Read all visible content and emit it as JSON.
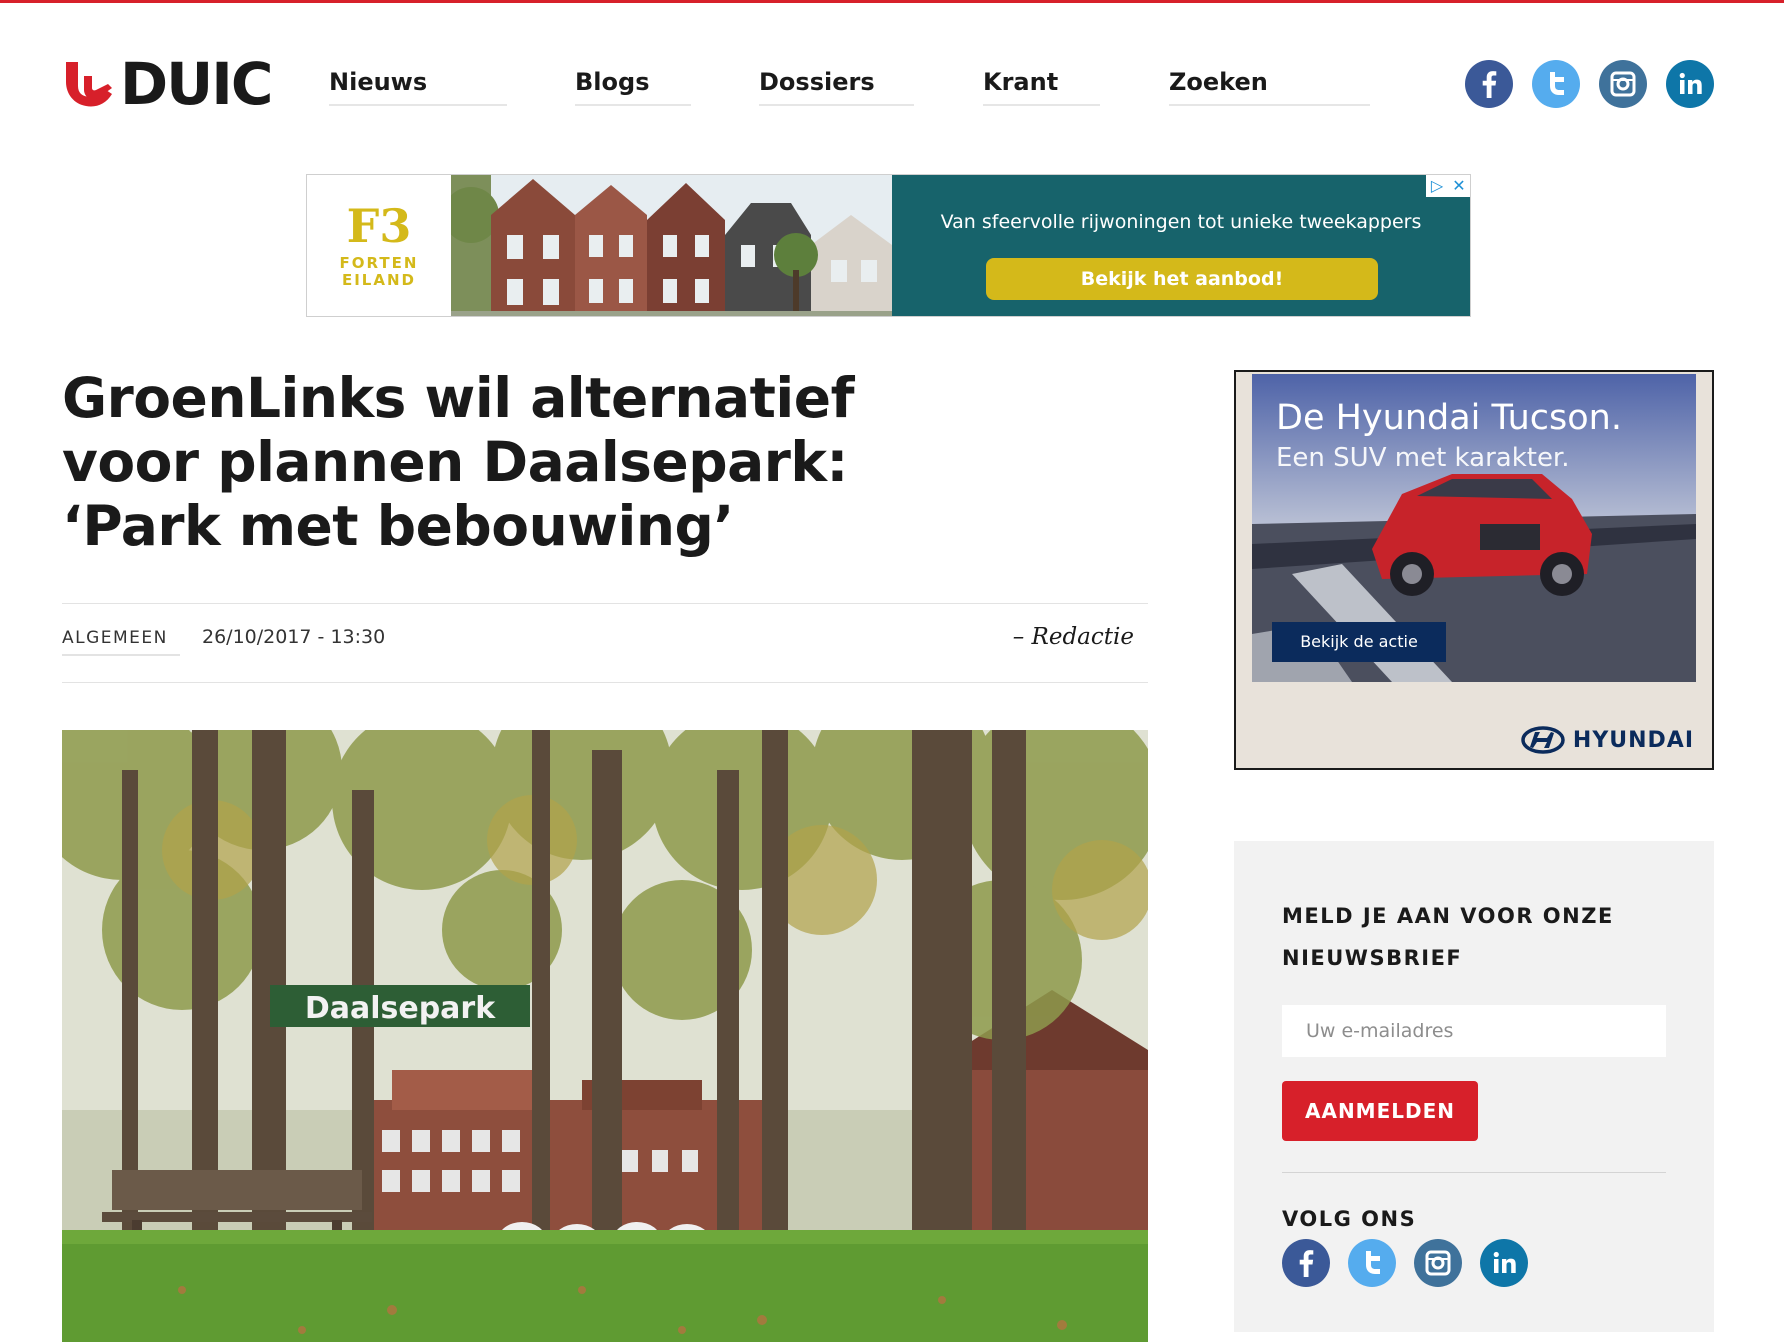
{
  "header": {
    "logo_text": "DUIC",
    "nav": [
      {
        "label": "Nieuws"
      },
      {
        "label": "Blogs"
      },
      {
        "label": "Dossiers"
      },
      {
        "label": "Krant"
      },
      {
        "label": "Zoeken"
      }
    ],
    "social": [
      "facebook-icon",
      "twitter-icon",
      "instagram-icon",
      "linkedin-icon"
    ]
  },
  "top_ad": {
    "logo_mark": "F3",
    "logo_line1": "FORTEN",
    "logo_line2": "EILAND",
    "headline": "Van sfeervolle rijwoningen tot unieke tweekappers",
    "cta": "Bekijk het aanbod!",
    "adchoices_icon": "▷",
    "close_icon": "✕"
  },
  "article": {
    "title": "GroenLinks wil alternatief voor plannen Daalsepark: ‘Park met bebouwing’",
    "category": "ALGEMEEN",
    "date": "26/10/2017 - 13:30",
    "author": "– Redactie",
    "image_banner_text": "Daalsepark"
  },
  "side_ad": {
    "headline": "De Hyundai Tucson.",
    "subline": "Een SUV met karakter.",
    "cta": "Bekijk de actie",
    "brand": "HYUNDAI"
  },
  "newsletter": {
    "title": "MELD JE AAN VOOR ONZE NIEUWSBRIEF",
    "email_placeholder": "Uw e-mailadres",
    "email_value": "",
    "submit_label": "AANMELDEN",
    "follow_label": "VOLG ONS"
  },
  "colors": {
    "brand_red": "#d7202a",
    "ad_teal": "#17636b",
    "ad_gold": "#d4b91a",
    "hyundai_navy": "#0b2b5c"
  }
}
